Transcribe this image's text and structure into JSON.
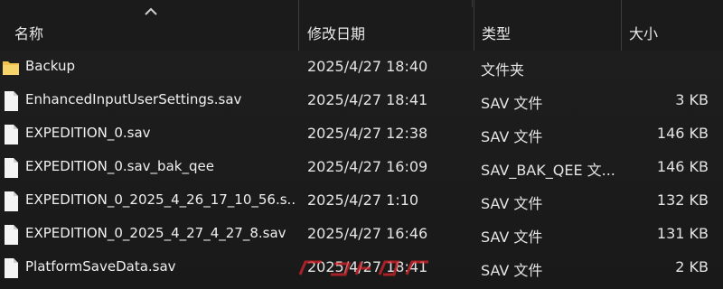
{
  "columns": {
    "name": "名称",
    "date": "修改日期",
    "type": "类型",
    "size": "大小"
  },
  "sort": {
    "column": "name",
    "icon": "chevron-up-icon"
  },
  "files": [
    {
      "name": "Backup",
      "date": "2025/4/27 18:40",
      "type": "文件夹",
      "size": "",
      "icon": "folder-icon"
    },
    {
      "name": "EnhancedInputUserSettings.sav",
      "date": "2025/4/27 18:41",
      "type": "SAV 文件",
      "size": "3 KB",
      "icon": "file-icon"
    },
    {
      "name": "EXPEDITION_0.sav",
      "date": "2025/4/27 12:38",
      "type": "SAV 文件",
      "size": "146 KB",
      "icon": "file-icon"
    },
    {
      "name": "EXPEDITION_0.sav_bak_qee",
      "date": "2025/4/27 16:09",
      "type": "SAV_BAK_QEE 文...",
      "size": "146 KB",
      "icon": "file-icon"
    },
    {
      "name": "EXPEDITION_0_2025_4_26_17_10_56.s...",
      "date": "2025/4/27 1:10",
      "type": "SAV 文件",
      "size": "132 KB",
      "icon": "file-icon"
    },
    {
      "name": "EXPEDITION_0_2025_4_27_4_27_8.sav",
      "date": "2025/4/27 16:46",
      "type": "SAV 文件",
      "size": "131 KB",
      "icon": "file-icon"
    },
    {
      "name": "PlatformSaveData.sav",
      "date": "2025/4/27 18:41",
      "type": "SAV 文件",
      "size": "2 KB",
      "icon": "file-icon"
    }
  ],
  "colors": {
    "background": "#1c1c1c",
    "text": "#e6e6e6",
    "folder": "#f2c14e",
    "divider": "#3d3d3d",
    "watermark": "#d8242c"
  }
}
